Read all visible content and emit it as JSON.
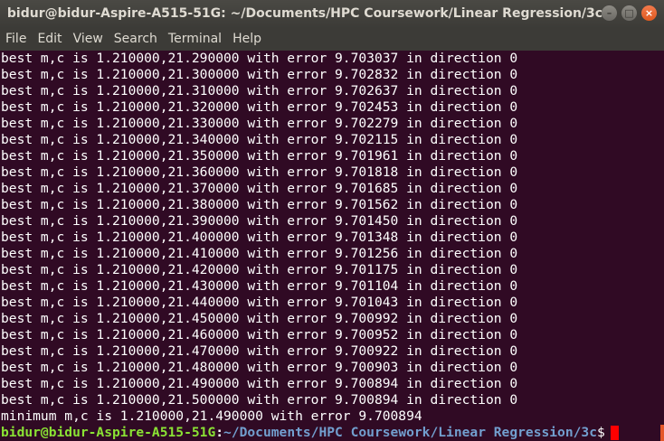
{
  "window": {
    "title": "bidur@bidur-Aspire-A515-51G: ~/Documents/HPC Coursework/Linear Regression/3c"
  },
  "controls": {
    "minimize": "–",
    "maximize": "□",
    "close": "×"
  },
  "menu": [
    "File",
    "Edit",
    "View",
    "Search",
    "Terminal",
    "Help"
  ],
  "lines": [
    "best m,c is 1.210000,21.290000 with error 9.703037 in direction 0",
    "best m,c is 1.210000,21.300000 with error 9.702832 in direction 0",
    "best m,c is 1.210000,21.310000 with error 9.702637 in direction 0",
    "best m,c is 1.210000,21.320000 with error 9.702453 in direction 0",
    "best m,c is 1.210000,21.330000 with error 9.702279 in direction 0",
    "best m,c is 1.210000,21.340000 with error 9.702115 in direction 0",
    "best m,c is 1.210000,21.350000 with error 9.701961 in direction 0",
    "best m,c is 1.210000,21.360000 with error 9.701818 in direction 0",
    "best m,c is 1.210000,21.370000 with error 9.701685 in direction 0",
    "best m,c is 1.210000,21.380000 with error 9.701562 in direction 0",
    "best m,c is 1.210000,21.390000 with error 9.701450 in direction 0",
    "best m,c is 1.210000,21.400000 with error 9.701348 in direction 0",
    "best m,c is 1.210000,21.410000 with error 9.701256 in direction 0",
    "best m,c is 1.210000,21.420000 with error 9.701175 in direction 0",
    "best m,c is 1.210000,21.430000 with error 9.701104 in direction 0",
    "best m,c is 1.210000,21.440000 with error 9.701043 in direction 0",
    "best m,c is 1.210000,21.450000 with error 9.700992 in direction 0",
    "best m,c is 1.210000,21.460000 with error 9.700952 in direction 0",
    "best m,c is 1.210000,21.470000 with error 9.700922 in direction 0",
    "best m,c is 1.210000,21.480000 with error 9.700903 in direction 0",
    "best m,c is 1.210000,21.490000 with error 9.700894 in direction 0",
    "best m,c is 1.210000,21.500000 with error 9.700894 in direction 0",
    "minimum m,c is 1.210000,21.490000 with error 9.700894"
  ],
  "prompt": {
    "user_host": "bidur@bidur-Aspire-A515-51G",
    "separator": ":",
    "path": "~/Documents/HPC Coursework/Linear Regression/3c",
    "symbol": "$"
  },
  "colors": {
    "background": "#300a24",
    "prompt_user": "#8ae234",
    "prompt_path": "#729fcf",
    "cursor": "#ff0000"
  }
}
